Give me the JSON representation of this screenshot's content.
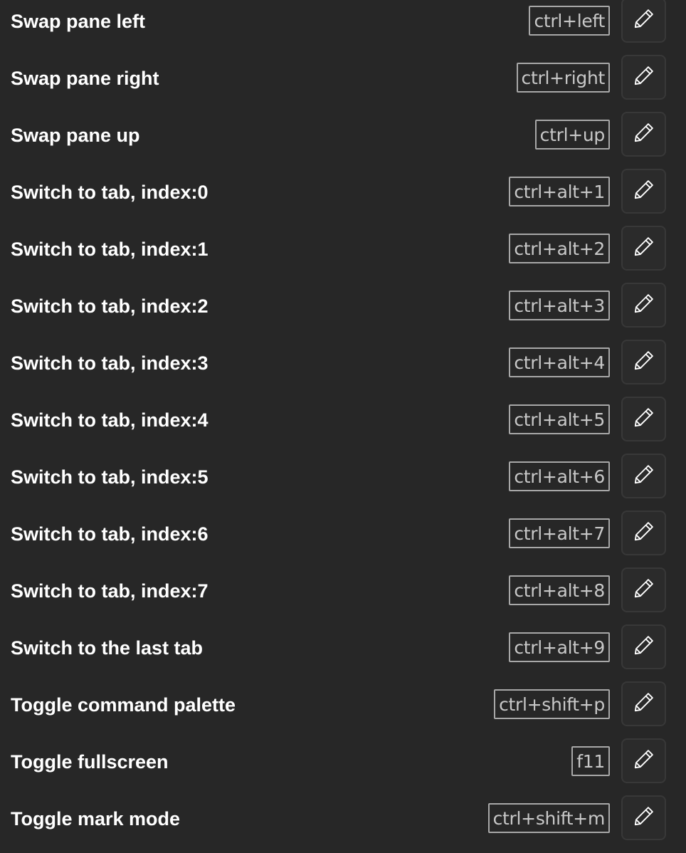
{
  "actions": [
    {
      "name": "Swap pane left",
      "keys": "ctrl+left",
      "icon": "pencil-icon"
    },
    {
      "name": "Swap pane right",
      "keys": "ctrl+right",
      "icon": "pencil-icon"
    },
    {
      "name": "Swap pane up",
      "keys": "ctrl+up",
      "icon": "pencil-icon"
    },
    {
      "name": "Switch to tab, index:0",
      "keys": "ctrl+alt+1",
      "icon": "pencil-icon"
    },
    {
      "name": "Switch to tab, index:1",
      "keys": "ctrl+alt+2",
      "icon": "pencil-icon"
    },
    {
      "name": "Switch to tab, index:2",
      "keys": "ctrl+alt+3",
      "icon": "pencil-icon"
    },
    {
      "name": "Switch to tab, index:3",
      "keys": "ctrl+alt+4",
      "icon": "pencil-icon"
    },
    {
      "name": "Switch to tab, index:4",
      "keys": "ctrl+alt+5",
      "icon": "pencil-icon"
    },
    {
      "name": "Switch to tab, index:5",
      "keys": "ctrl+alt+6",
      "icon": "pencil-icon"
    },
    {
      "name": "Switch to tab, index:6",
      "keys": "ctrl+alt+7",
      "icon": "pencil-icon"
    },
    {
      "name": "Switch to tab, index:7",
      "keys": "ctrl+alt+8",
      "icon": "pencil-icon"
    },
    {
      "name": "Switch to the last tab",
      "keys": "ctrl+alt+9",
      "icon": "pencil-icon"
    },
    {
      "name": "Toggle command palette",
      "keys": "ctrl+shift+p",
      "icon": "pencil-icon"
    },
    {
      "name": "Toggle fullscreen",
      "keys": "f11",
      "icon": "pencil-icon"
    },
    {
      "name": "Toggle mark mode",
      "keys": "ctrl+shift+m",
      "icon": "pencil-icon"
    }
  ],
  "colors": {
    "background": "#272727",
    "text": "#ffffff",
    "keys_text": "#c8c8c8",
    "keys_border": "#a8a8a8",
    "button_border": "#383838"
  }
}
